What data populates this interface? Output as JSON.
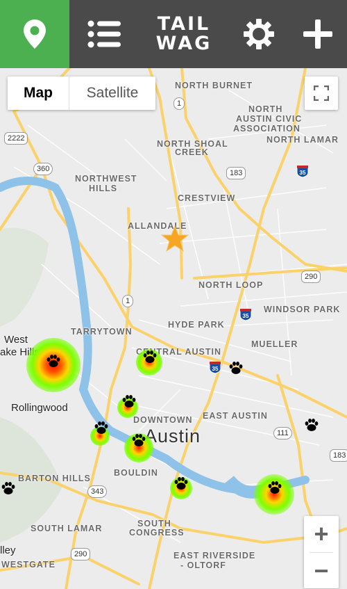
{
  "app": {
    "logo_line1": "TAIL",
    "logo_line2": "WAG"
  },
  "topbar": {
    "map_icon": "map-pin-icon",
    "list_icon": "list-icon",
    "settings_icon": "gear-icon",
    "add_icon": "plus-icon"
  },
  "map_type": {
    "map_label": "Map",
    "satellite_label": "Satellite",
    "selected": "Map"
  },
  "zoom": {
    "in_label": "+",
    "out_label": "−"
  },
  "labels": {
    "north_burnet": "NORTH BURNET",
    "north_austin_civic_1": "NORTH",
    "north_austin_civic_2": "AUSTIN CIVIC",
    "north_austin_civic_3": "ASSOCIATION",
    "north_lamar": "NORTH LAMAR",
    "north_shoal_creek_1": "NORTH SHOAL",
    "north_shoal_creek_2": "CREEK",
    "northwest_hills_1": "NORTHWEST",
    "northwest_hills_2": "HILLS",
    "crestview": "CRESTVIEW",
    "allandale": "ALLANDALE",
    "north_loop": "NORTH LOOP",
    "windsor_park": "WINDSOR PARK",
    "hyde_park": "HYDE PARK",
    "tarrytown": "TARRYTOWN",
    "central_austin": "CENTRAL AUSTIN",
    "mueller": "MUELLER",
    "west_lake_hills_1": "West",
    "west_lake_hills_2": "ake Hills",
    "rollingwood": "Rollingwood",
    "downtown": "DOWNTOWN",
    "east_austin": "EAST AUSTIN",
    "austin": "Austin",
    "barton_hills": "BARTON HILLS",
    "bouldin": "BOULDIN",
    "south_congress_1": "SOUTH",
    "south_congress_2": "CONGRESS",
    "south_lamar": "SOUTH LAMAR",
    "valley": "lley",
    "westgate": "WESTGATE",
    "east_riverside_1": "EAST RIVERSIDE",
    "east_riverside_2": "- OLTORF"
  },
  "road_shields": {
    "r2222": "2222",
    "r360": "360",
    "r1_top": "1",
    "r1_mid": "1",
    "r183": "183",
    "r290_east": "290",
    "r111": "111",
    "r343": "343",
    "r290_south": "290",
    "r183_right": "183",
    "i35_a": "35",
    "i35_b": "35",
    "i35_c": "35"
  },
  "markers": {
    "user_location_icon": "star-icon",
    "dog_marker_icon": "paw-icon",
    "count": 11
  },
  "colors": {
    "green": "#4caf50",
    "topbar": "#4a4a4a",
    "road": "#fbd26a",
    "water": "#8ec2e8",
    "star": "#f5a623"
  }
}
